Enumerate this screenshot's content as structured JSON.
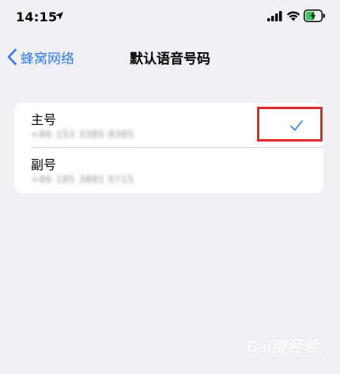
{
  "status_bar": {
    "time": "14:15",
    "icons": [
      "location-arrow-icon",
      "cellular-signal-icon",
      "wifi-icon",
      "battery-charging-icon"
    ],
    "battery_color": "#34c759"
  },
  "nav": {
    "back_label": "蜂窝网络",
    "title": "默认语音号码"
  },
  "list": {
    "rows": [
      {
        "title": "主号",
        "subtitle": "+86 153 3385 8385",
        "selected": true
      },
      {
        "title": "副号",
        "subtitle": "+86 185 3881 0715",
        "selected": false
      }
    ]
  },
  "accent_color": "#2f7bf5",
  "highlight_color": "#e02929",
  "watermark": {
    "logo": "Bai度经验",
    "sub": "jingyan.baidu.com"
  }
}
